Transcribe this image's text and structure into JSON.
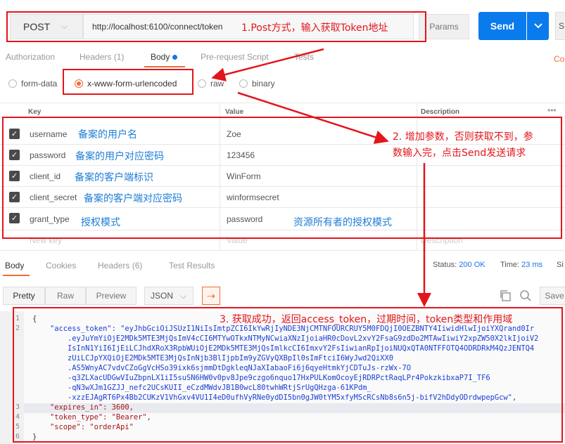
{
  "request": {
    "method": "POST",
    "url": "http://localhost:6100/connect/token",
    "params_label": "Params",
    "send_label": "Send",
    "save_label": "S"
  },
  "request_tabs": [
    {
      "label": "Authorization"
    },
    {
      "label": "Headers (1)"
    },
    {
      "label": "Body"
    },
    {
      "label": "Pre-request Script"
    },
    {
      "label": "Tests"
    },
    {
      "label": "Co"
    }
  ],
  "body_types": [
    {
      "label": "form-data",
      "selected": false
    },
    {
      "label": "x-www-form-urlencoded",
      "selected": true
    },
    {
      "label": "raw",
      "selected": false
    },
    {
      "label": "binary",
      "selected": false
    }
  ],
  "table": {
    "headers": {
      "key": "Key",
      "value": "Value",
      "description": "Description"
    },
    "rows": [
      {
        "key": "username",
        "note": "备案的用户名",
        "value": "Zoe",
        "value_note": ""
      },
      {
        "key": "password",
        "note": "备案的用户对应密码",
        "value": "123456",
        "value_note": ""
      },
      {
        "key": "client_id",
        "note": "备案的客户端标识",
        "value": "WinForm",
        "value_note": ""
      },
      {
        "key": "client_secret",
        "note": "备案的客户端对应密码",
        "value": "winformsecret",
        "value_note": ""
      },
      {
        "key": "grant_type",
        "note": "授权模式",
        "value": "password",
        "value_note": "资源所有者的授权模式"
      }
    ],
    "new_row": {
      "key": "New key",
      "value": "Value",
      "description": "Description"
    }
  },
  "response": {
    "tabs": [
      {
        "label": "Body"
      },
      {
        "label": "Cookies"
      },
      {
        "label": "Headers (6)"
      },
      {
        "label": "Test Results"
      }
    ],
    "status_label": "Status:",
    "status_value": "200 OK",
    "time_label": "Time:",
    "time_value": "23 ms",
    "size_label": "Si",
    "formats": [
      "Pretty",
      "Raw",
      "Preview"
    ],
    "format_type": "JSON",
    "save_label": "Save",
    "line_numbers": [
      "1",
      "2",
      "",
      "",
      "",
      "",
      "",
      "",
      "",
      "3",
      "4",
      "5",
      "6"
    ],
    "code_lines": [
      "{",
      "    \"access_token\": \"eyJhbGciOiJSUzI1NiIsImtpZCI6IkYwRjIyNDE3NjCMTNFOURCRUY5M0FDQjI0OEZBNTY4IiwidHlwIjoiYXQrand0Ir",
      "        .eyJuYmYiOjE2MDk5MTE3MjQsImV4cCI6MTYwOTkxNTMyNCwiaXNzIjoiaHR0cDovL2xvY2FsaG9zdDo2MTAwIiwiY2xpZW50X2lkIjoiV2",
      "        IsInN1YiI6IjEiLCJhdXRoX3RpbWUiOjE2MDk5MTE3MjQsImlkcCI6ImxvY2FsIiwianRpIjoiNUQxQTA0NTFFOTQ4ODRDRkM4QzJENTQ4",
      "        zUiLCJpYXQiOjE2MDk5MTE3MjQsInNjb3BlIjpbIm9yZGVyQXBpIl0sImFtciI6WyJwd2QiXX0",
      "        .AS5WnyAC7vdvCZoGgVcHSo39ixk6sjmmDtDgkleqNJaXIabaoFi6j6qyeHtmkYjCDTuJs-rzWx-7O",
      "        -q3ZLXacUDGwVIuZbpnLX1iI5suSN6HW0v0pv8Jpe9czgo6nquo17HxPULKomOcoyEjRDRPctRaqLPr4PokzkibxaP7I_TF6",
      "        -qN3wXJm1GZJJ_nefc2UCsKUII_eCzdMWdvJB1B0wcL80twhWRtjSrUgQHzga-61KPdm_",
      "        -xzzEJAgRT6Px4Bb2CUKzV1VhGxv4VU1I4eD0ufhVyRNe0ydDI5bn0gJW0tYM5xfyMScRCsNb8s6n5j-bifV2hDdyODrdwpepGcw\",",
      "    \"expires_in\": 3600,",
      "    \"token_type\": \"Bearer\",",
      "    \"scope\": \"orderApi\"",
      "}"
    ]
  },
  "annotations": {
    "a1": "1.Post方式，输入获取Token地址",
    "a2_line1": "2. 增加参数，否则获取不到，参",
    "a2_line2": "数输入完，点击Send发送请求",
    "a3": "3. 获取成功，返回access_token，过期时间，token类型和作用域"
  },
  "colors": {
    "accent": "#f26b3a",
    "send": "#097bed",
    "annotation_red": "#e3151b",
    "annotation_blue": "#1e7dd6",
    "status_green": "#1e9b4a"
  }
}
